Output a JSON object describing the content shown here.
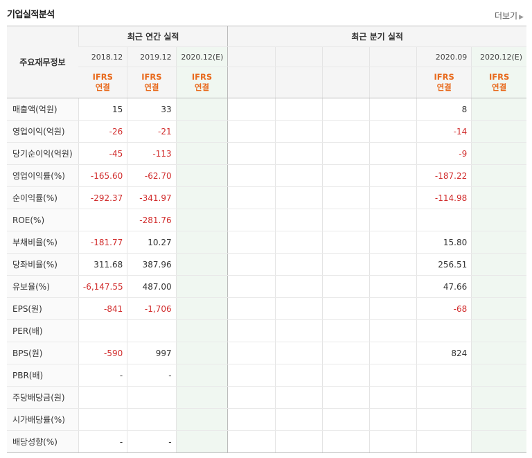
{
  "header": {
    "title": "기업실적분석",
    "more_label": "더보기"
  },
  "table": {
    "row_header": "주요재무정보",
    "annual_label": "최근 연간 실적",
    "quarter_label": "최근 분기 실적",
    "annual_periods": [
      "2018.12",
      "2019.12",
      "2020.12(E)"
    ],
    "quarter_periods": [
      "",
      "",
      "",
      "",
      "2020.09",
      "2020.12(E)"
    ],
    "ifrs_line1": "IFRS",
    "ifrs_line2": "연결",
    "rows": [
      {
        "name": "매출액(억원)",
        "annual": [
          "15",
          "33",
          ""
        ],
        "quarter": [
          "",
          "",
          "",
          "",
          "8",
          ""
        ]
      },
      {
        "name": "영업이익(억원)",
        "annual": [
          "-26",
          "-21",
          ""
        ],
        "quarter": [
          "",
          "",
          "",
          "",
          "-14",
          ""
        ]
      },
      {
        "name": "당기순이익(억원)",
        "annual": [
          "-45",
          "-113",
          ""
        ],
        "quarter": [
          "",
          "",
          "",
          "",
          "-9",
          ""
        ]
      },
      {
        "name": "영업이익률(%)",
        "annual": [
          "-165.60",
          "-62.70",
          ""
        ],
        "quarter": [
          "",
          "",
          "",
          "",
          "-187.22",
          ""
        ]
      },
      {
        "name": "순이익률(%)",
        "annual": [
          "-292.37",
          "-341.97",
          ""
        ],
        "quarter": [
          "",
          "",
          "",
          "",
          "-114.98",
          ""
        ]
      },
      {
        "name": "ROE(%)",
        "annual": [
          "",
          "-281.76",
          ""
        ],
        "quarter": [
          "",
          "",
          "",
          "",
          "",
          ""
        ]
      },
      {
        "name": "부채비율(%)",
        "annual": [
          "-181.77",
          "10.27",
          ""
        ],
        "quarter": [
          "",
          "",
          "",
          "",
          "15.80",
          ""
        ]
      },
      {
        "name": "당좌비율(%)",
        "annual": [
          "311.68",
          "387.96",
          ""
        ],
        "quarter": [
          "",
          "",
          "",
          "",
          "256.51",
          ""
        ]
      },
      {
        "name": "유보율(%)",
        "annual": [
          "-6,147.55",
          "487.00",
          ""
        ],
        "quarter": [
          "",
          "",
          "",
          "",
          "47.66",
          ""
        ]
      },
      {
        "name": "EPS(원)",
        "annual": [
          "-841",
          "-1,706",
          ""
        ],
        "quarter": [
          "",
          "",
          "",
          "",
          "-68",
          ""
        ]
      },
      {
        "name": "PER(배)",
        "annual": [
          "",
          "",
          ""
        ],
        "quarter": [
          "",
          "",
          "",
          "",
          "",
          ""
        ]
      },
      {
        "name": "BPS(원)",
        "annual": [
          "-590",
          "997",
          ""
        ],
        "quarter": [
          "",
          "",
          "",
          "",
          "824",
          ""
        ]
      },
      {
        "name": "PBR(배)",
        "annual": [
          "-",
          "-",
          ""
        ],
        "quarter": [
          "",
          "",
          "",
          "",
          "",
          ""
        ]
      },
      {
        "name": "주당배당금(원)",
        "annual": [
          "",
          "",
          ""
        ],
        "quarter": [
          "",
          "",
          "",
          "",
          "",
          ""
        ]
      },
      {
        "name": "시가배당률(%)",
        "annual": [
          "",
          "",
          ""
        ],
        "quarter": [
          "",
          "",
          "",
          "",
          "",
          ""
        ]
      },
      {
        "name": "배당성향(%)",
        "annual": [
          "-",
          "-",
          ""
        ],
        "quarter": [
          "",
          "",
          "",
          "",
          "",
          ""
        ]
      }
    ]
  },
  "colors": {
    "negative": "#d12b2b",
    "ifrs": "#e86a1d",
    "estimate_bg": "#f0f7f1"
  }
}
